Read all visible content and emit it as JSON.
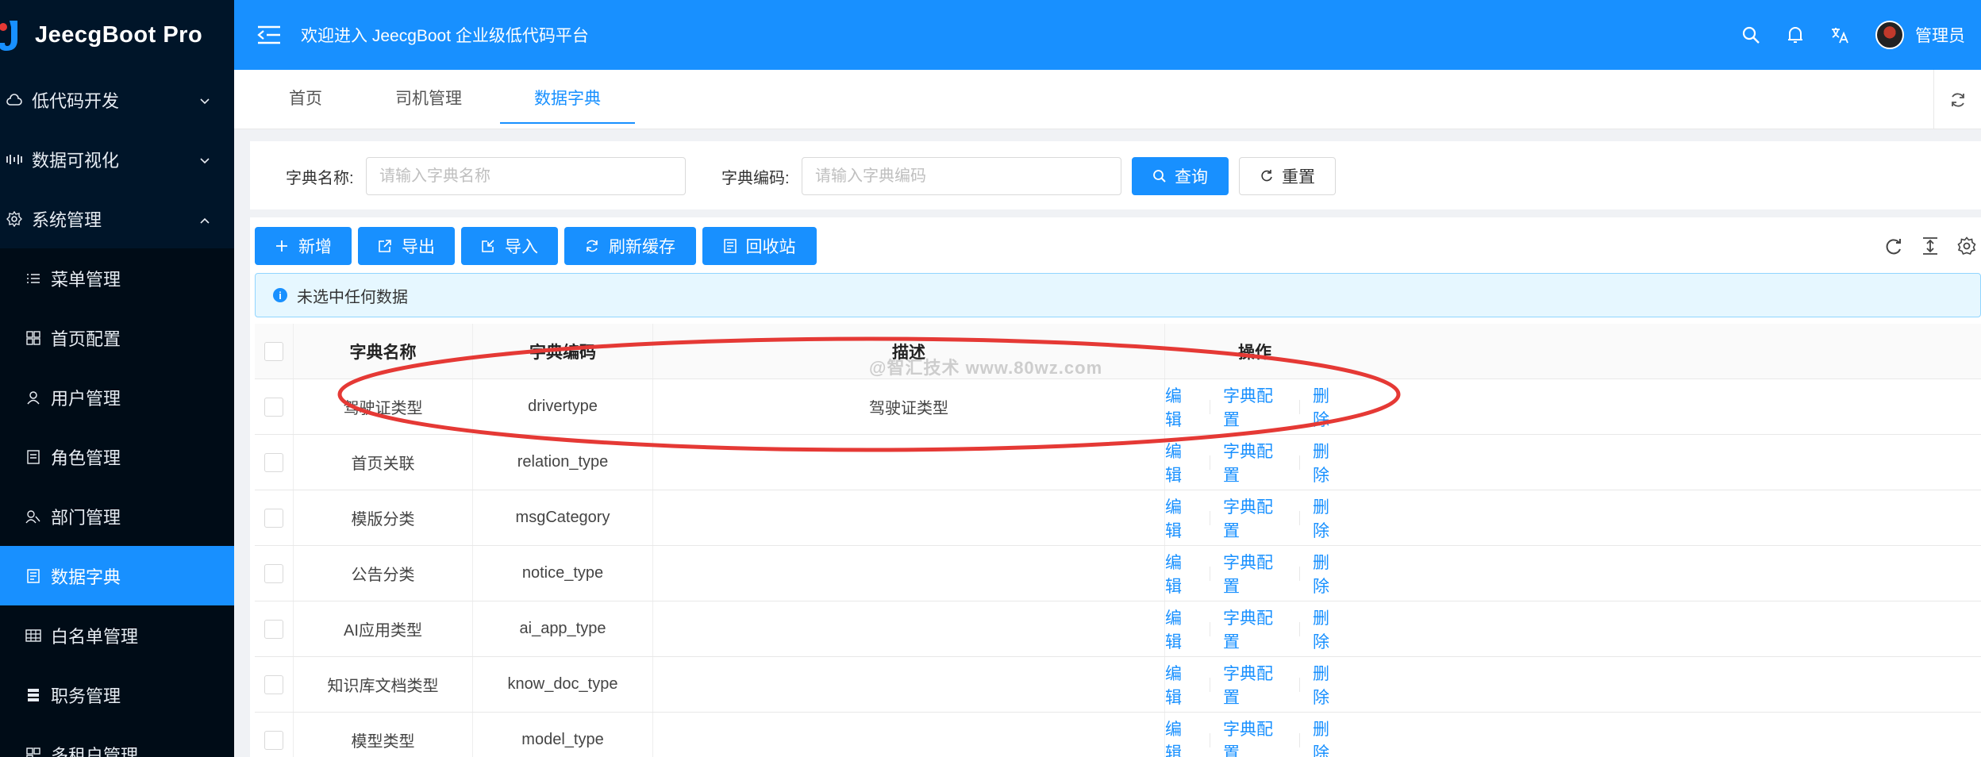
{
  "app": {
    "brand": "JeecgBoot Pro",
    "welcome": "欢迎进入 JeecgBoot 企业级低代码平台",
    "user_name": "管理员"
  },
  "sidebar": {
    "items": [
      {
        "label": "低代码开发",
        "icon": "cloud-icon",
        "level": "top",
        "expanded": false
      },
      {
        "label": "数据可视化",
        "icon": "bar-chart-icon",
        "level": "top",
        "expanded": false
      },
      {
        "label": "系统管理",
        "icon": "gear-icon",
        "level": "top",
        "expanded": true
      },
      {
        "label": "菜单管理",
        "icon": "menu-list-icon",
        "level": "sub"
      },
      {
        "label": "首页配置",
        "icon": "grid-icon",
        "level": "sub"
      },
      {
        "label": "用户管理",
        "icon": "user-icon",
        "level": "sub"
      },
      {
        "label": "角色管理",
        "icon": "role-icon",
        "level": "sub"
      },
      {
        "label": "部门管理",
        "icon": "team-icon",
        "level": "sub"
      },
      {
        "label": "数据字典",
        "icon": "book-icon",
        "level": "sub",
        "active": true
      },
      {
        "label": "白名单管理",
        "icon": "table-icon",
        "level": "sub"
      },
      {
        "label": "职务管理",
        "icon": "database-icon",
        "level": "sub"
      },
      {
        "label": "多租户管理",
        "icon": "tenant-icon",
        "level": "sub"
      }
    ]
  },
  "tabs": [
    {
      "label": "首页"
    },
    {
      "label": "司机管理"
    },
    {
      "label": "数据字典",
      "active": true
    }
  ],
  "search": {
    "name_label": "字典名称:",
    "name_placeholder": "请输入字典名称",
    "code_label": "字典编码:",
    "code_placeholder": "请输入字典编码",
    "query_label": "查询",
    "reset_label": "重置"
  },
  "toolbar": {
    "add_label": "新增",
    "export_label": "导出",
    "import_label": "导入",
    "refresh_cache_label": "刷新缓存",
    "recycle_label": "回收站"
  },
  "alert": {
    "text": "未选中任何数据"
  },
  "table": {
    "columns": [
      "字典名称",
      "字典编码",
      "描述",
      "操作"
    ],
    "rows": [
      {
        "name": "驾驶证类型",
        "code": "drivertype",
        "desc": "驾驶证类型"
      },
      {
        "name": "首页关联",
        "code": "relation_type",
        "desc": ""
      },
      {
        "name": "模版分类",
        "code": "msgCategory",
        "desc": ""
      },
      {
        "name": "公告分类",
        "code": "notice_type",
        "desc": ""
      },
      {
        "name": "AI应用类型",
        "code": "ai_app_type",
        "desc": ""
      },
      {
        "name": "知识库文档类型",
        "code": "know_doc_type",
        "desc": ""
      },
      {
        "name": "模型类型",
        "code": "model_type",
        "desc": ""
      }
    ],
    "actions": {
      "edit": "编辑",
      "config": "字典配置",
      "delete": "删除"
    }
  },
  "watermark": "@智汇技术 www.80wz.com",
  "colors": {
    "primary": "#1890ff",
    "sidebar_bg": "#001529",
    "annotation": "#e53935"
  }
}
